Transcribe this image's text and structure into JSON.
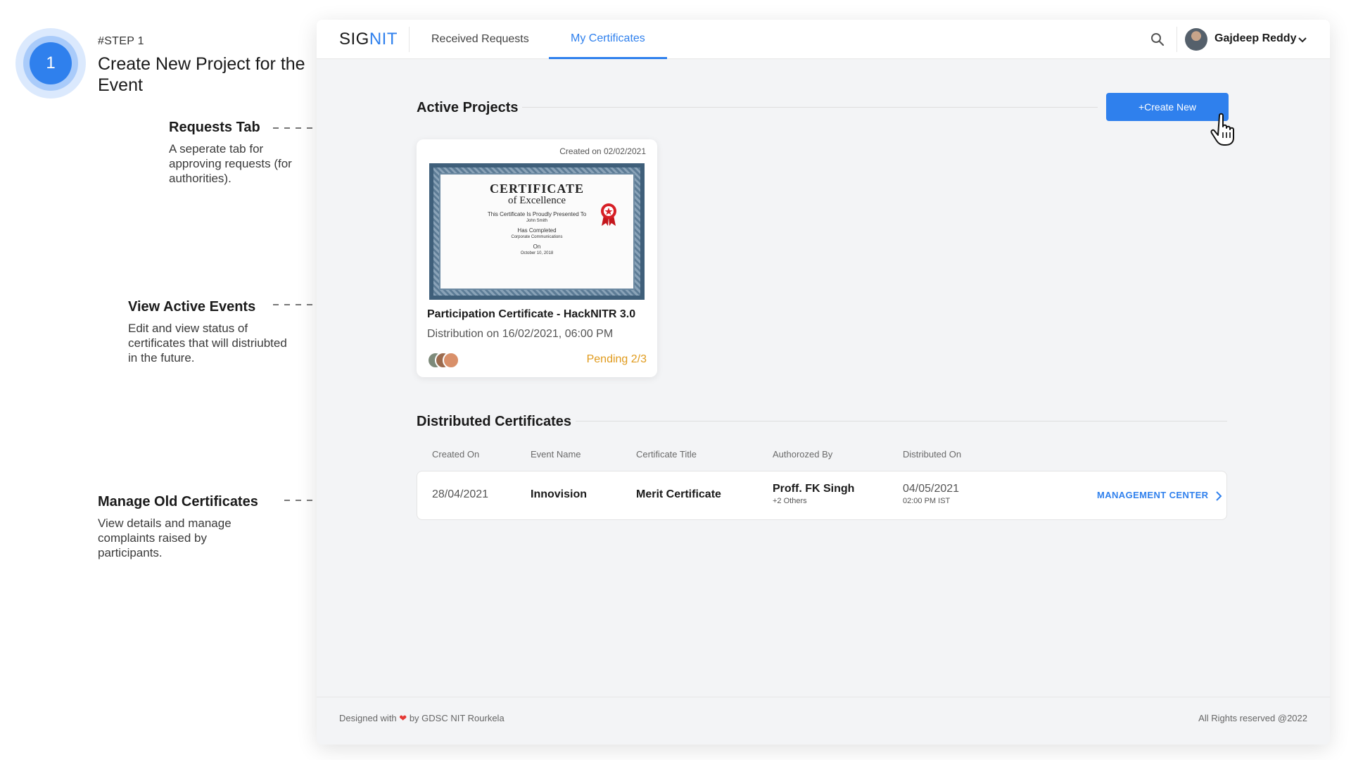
{
  "step": {
    "number": "1",
    "label": "#STEP 1",
    "title": "Create New Project for the Event"
  },
  "notes": {
    "requests": {
      "title": "Requests Tab",
      "desc": "A seperate tab for approving requests (for authorities)."
    },
    "active": {
      "title": "View Active Events",
      "desc": "Edit and view status of certificates that will distriubted in the future."
    },
    "old": {
      "title": "Manage Old Certificates",
      "desc": "View details and manage complaints raised by participants."
    }
  },
  "app": {
    "logo_a": "SIG",
    "logo_b": "NIT",
    "tabs": [
      {
        "label": "Received Requests",
        "active": false
      },
      {
        "label": "My Certificates",
        "active": true
      }
    ],
    "user": {
      "name": "Gajdeep Reddy"
    },
    "icons": {
      "search": "search-icon",
      "dropdown": "chevron-down-icon",
      "cursor": "hand-pointer-icon"
    }
  },
  "active_projects": {
    "title": "Active Projects",
    "create_label": "+Create New",
    "cards": [
      {
        "created": "Created on 02/02/2021",
        "title": "Participation Certificate - HackNITR 3.0",
        "distribution": "Distribution on 16/02/2021, 06:00 PM",
        "status": "Pending 2/3",
        "certificate": {
          "heading": "CERTIFICATE",
          "subheading": "of Excellence",
          "presented": "This Certificate Is Proudly Presented To",
          "name": "John Smith",
          "completed": "Has Completed",
          "course": "Corporate Communications",
          "on": "On",
          "date": "October 10, 2018"
        }
      }
    ]
  },
  "distributed": {
    "title": "Distributed Certificates",
    "headers": [
      "Created On",
      "Event Name",
      "Certificate Title",
      "Authorozed By",
      "Distributed On"
    ],
    "rows": [
      {
        "created_on": "28/04/2021",
        "event": "Innovision",
        "certificate": "Merit Certificate",
        "authorized_by": "Proff. FK Singh",
        "authorized_extra": "+2 Others",
        "distributed_date": "04/05/2021",
        "distributed_time": "02:00 PM IST",
        "action": "MANAGEMENT CENTER"
      }
    ]
  },
  "footer": {
    "left_a": "Designed with",
    "left_b": "by GDSC NIT Rourkela",
    "right": "All Rights reserved @2022"
  },
  "colors": {
    "accent": "#2f80ed",
    "pending": "#e09a1b",
    "heart": "#e53935"
  }
}
